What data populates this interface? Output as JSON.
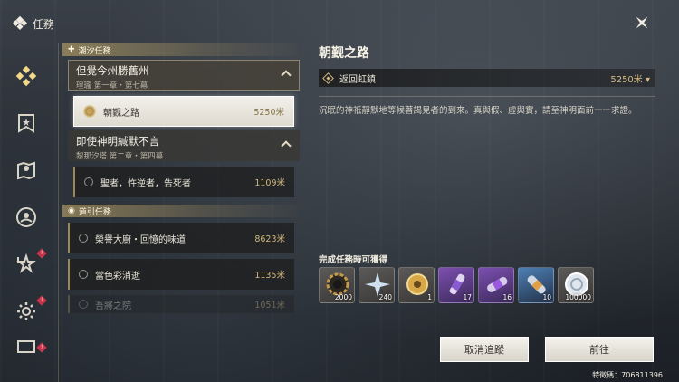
{
  "header": {
    "title": "任務",
    "icon": "quest-diamond-icon"
  },
  "close": {
    "icon": "close-x-icon"
  },
  "rail": [
    {
      "icon": "quest-icon",
      "active": true,
      "badge": ""
    },
    {
      "icon": "bookmark-shield-icon",
      "badge": ""
    },
    {
      "icon": "map-icon",
      "badge": ""
    },
    {
      "icon": "target-icon",
      "badge": ""
    },
    {
      "icon": "return-star-icon",
      "badge": "!"
    },
    {
      "icon": "gear-icon",
      "badge": "!"
    },
    {
      "icon": "monitor-icon",
      "badge": "!"
    }
  ],
  "list": {
    "section1": "潮汐任務",
    "chapters": [
      {
        "title": "但覺今州勝舊州",
        "sub": "瑝瓏 第一章・第七幕"
      },
      {
        "title": "即使神明緘默不言",
        "sub": "黎那汐塔 第二章・第四幕"
      }
    ],
    "quests1": [
      {
        "name": "朝觐之路",
        "dist": "5250米"
      },
      {
        "name": "聖者，忤逆者，告死者",
        "dist": "1109米"
      }
    ],
    "section2": "道引任務",
    "quests2": [
      {
        "name": "榮譽大廚・回憶的味道",
        "dist": "8623米"
      },
      {
        "name": "當色彩消逝",
        "dist": "1135米"
      },
      {
        "name": "吾將之院",
        "dist": "1051米"
      }
    ]
  },
  "detail": {
    "title": "朝觐之路",
    "location": "返回虹鎮",
    "distance": "5250米",
    "description": "沉眠的神祇靜默地等候著謁見者的到來。真與假、虛與實，請至神明面前一一求證。"
  },
  "rewards": {
    "title": "完成任務時可獲得",
    "items": [
      {
        "icon": "shell-credit-icon",
        "count": "2000",
        "rarity": "grey"
      },
      {
        "icon": "crystal-star-icon",
        "count": "240",
        "rarity": "grey"
      },
      {
        "icon": "gold-disc-icon",
        "count": "1",
        "rarity": "grey"
      },
      {
        "icon": "purple-tube-icon",
        "count": "17",
        "rarity": "purple"
      },
      {
        "icon": "purple-capsule-icon",
        "count": "16",
        "rarity": "purple"
      },
      {
        "icon": "blue-capsule-icon",
        "count": "10",
        "rarity": "blue"
      },
      {
        "icon": "silver-coin-icon",
        "count": "100000",
        "rarity": "grey"
      }
    ]
  },
  "buttons": {
    "cancel": "取消追蹤",
    "go": "前往"
  },
  "uid": "特徵碼：706811396"
}
